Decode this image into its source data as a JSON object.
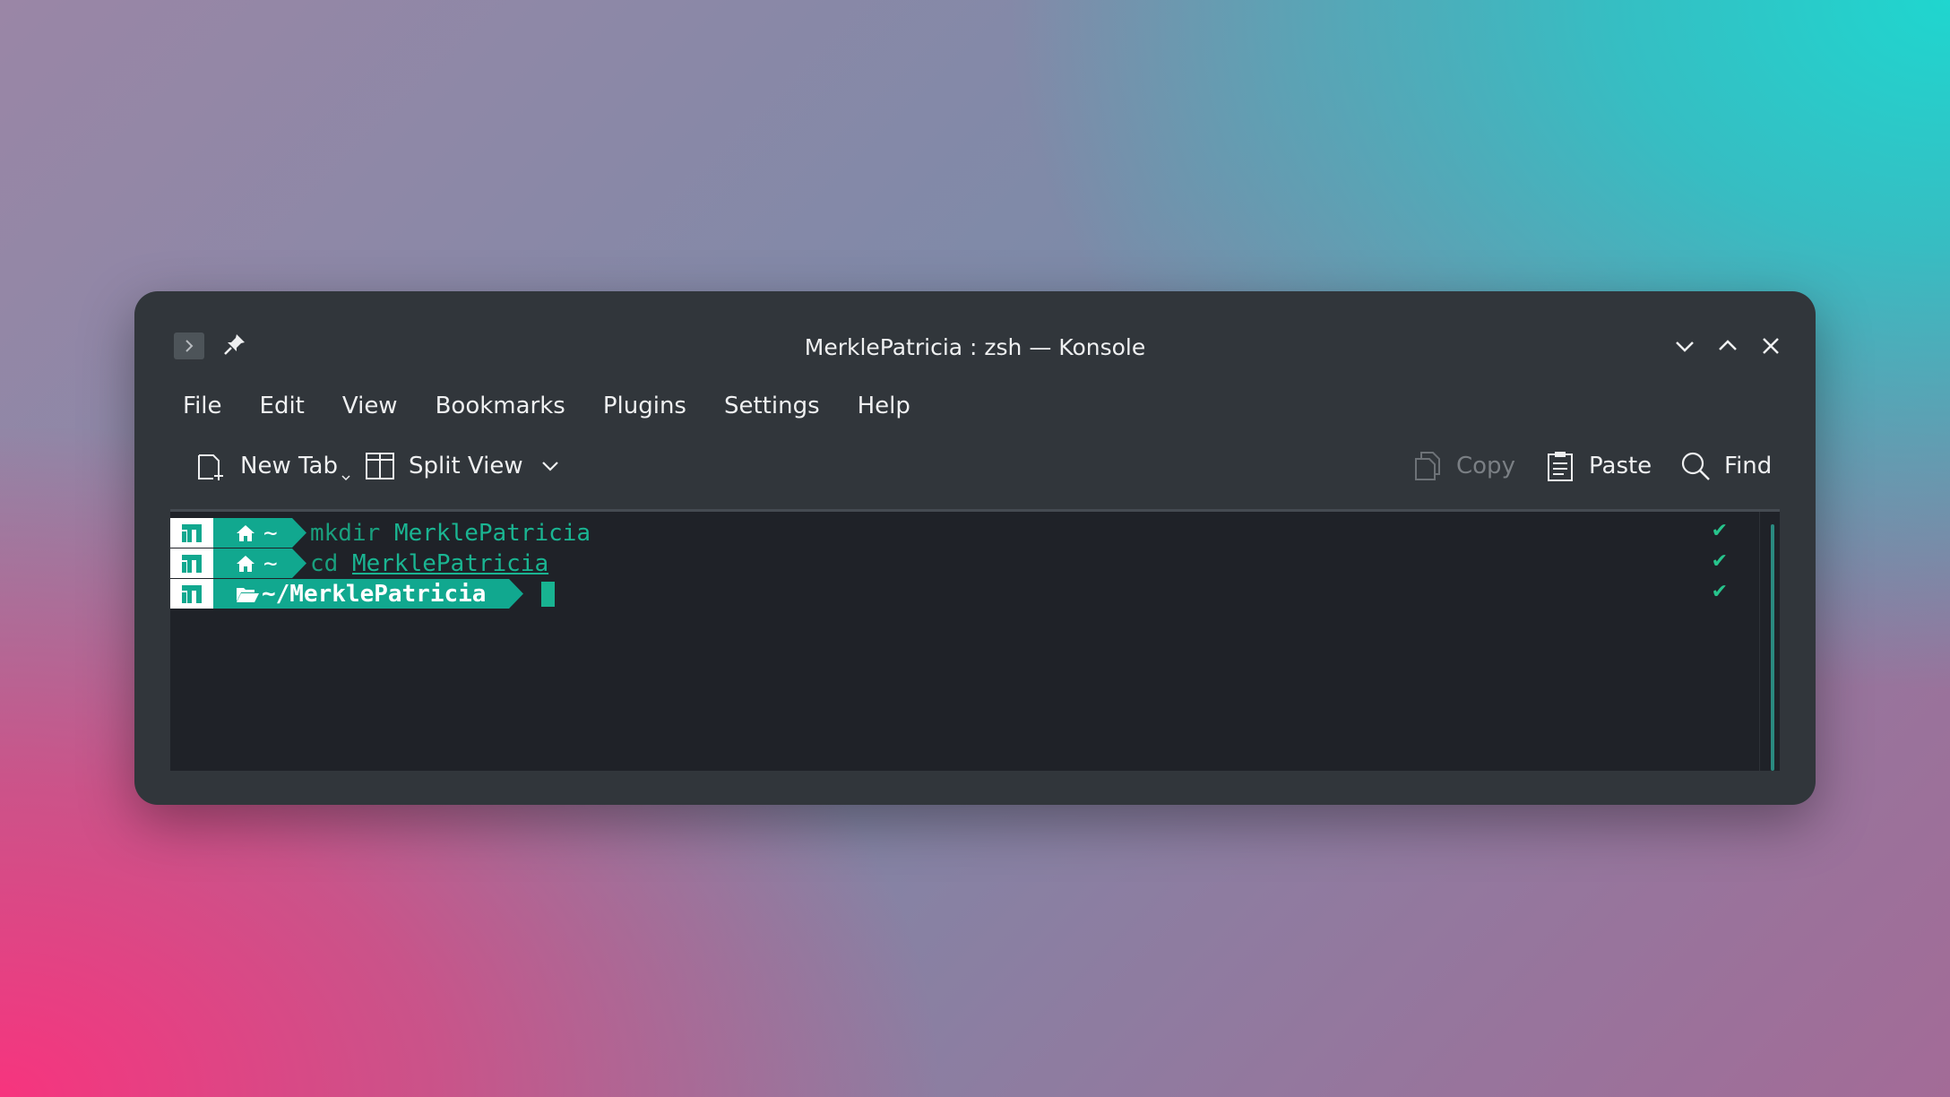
{
  "window": {
    "title": "MerklePatricia : zsh — Konsole"
  },
  "menubar": {
    "items": [
      "File",
      "Edit",
      "View",
      "Bookmarks",
      "Plugins",
      "Settings",
      "Help"
    ]
  },
  "toolbar": {
    "new_tab": "New Tab",
    "split_view": "Split View",
    "copy": "Copy",
    "paste": "Paste",
    "find": "Find"
  },
  "terminal": {
    "lines": [
      {
        "path": "~",
        "command": "mkdir",
        "argument": "MerklePatricia",
        "status": "✔"
      },
      {
        "path": "~",
        "command": "cd",
        "argument": "MerklePatricia",
        "status": "✔"
      },
      {
        "path": "~/MerklePatricia",
        "command": "",
        "argument": "",
        "status": "✔"
      }
    ]
  },
  "colors": {
    "window_bg": "#31363b",
    "terminal_bg": "#1f2228",
    "prompt_teal": "#11a88f",
    "command_green": "#1ab592"
  }
}
